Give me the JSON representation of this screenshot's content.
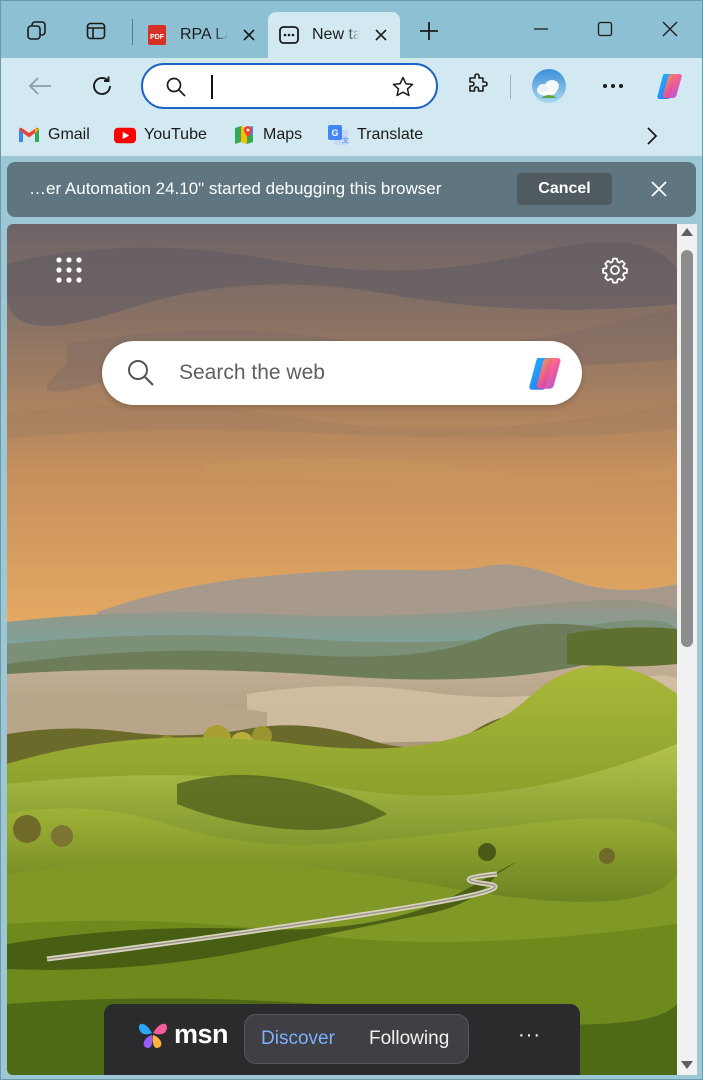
{
  "tabs": [
    {
      "title": "RPA LA",
      "favicon": "pdf-icon"
    },
    {
      "title": "New tab",
      "favicon": "new-tab-icon"
    }
  ],
  "address_bar": {
    "value": "",
    "placeholder": ""
  },
  "favorites": [
    {
      "label": "Gmail",
      "icon": "gmail-icon"
    },
    {
      "label": "YouTube",
      "icon": "youtube-icon"
    },
    {
      "label": "Maps",
      "icon": "maps-icon"
    },
    {
      "label": "Translate",
      "icon": "translate-icon"
    }
  ],
  "infobar": {
    "message": "…er Automation 24.10\" started debugging this browser",
    "cancel_label": "Cancel"
  },
  "ntp": {
    "search_placeholder": "Search the web",
    "msn_brand": "msn",
    "feed_tabs": [
      "Discover",
      "Following"
    ],
    "active_feed_tab": "Discover",
    "more_label": "···"
  },
  "colors": {
    "tab_strip": "#8cc0d2",
    "toolbar": "#d3e9f1",
    "address_focus": "#1f63c6",
    "infobar": "#5f7680",
    "msn_bar": "#2b2b2e",
    "discover_accent": "#7cb0ff"
  }
}
